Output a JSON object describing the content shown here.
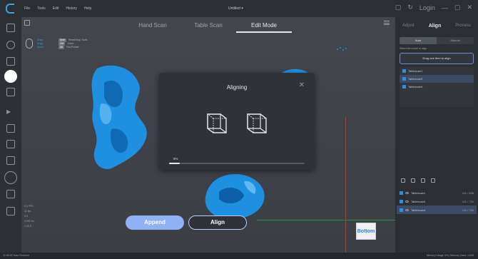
{
  "app": {
    "menu": [
      "File",
      "Tools",
      "Edit",
      "History",
      "Help"
    ],
    "doc_title": "Untitled  ▾",
    "login": "Login"
  },
  "tabs": [
    "Hand Scan",
    "Table Scan",
    "Edit Mode"
  ],
  "active_tab": 2,
  "hint": {
    "rows": [
      "Drag",
      "Drag",
      "Scroll"
    ],
    "tags": [
      "Shift",
      "Ctrl",
      "Alt"
    ],
    "labels": [
      "Reset/Stop Tools",
      "Zoom",
      "Pan/Rotate"
    ]
  },
  "dialog": {
    "title": "Aligning",
    "progress_label": "8%",
    "progress": 0.08
  },
  "buttons": {
    "append": "Append",
    "align": "Align"
  },
  "stats": [
    "0.0 FPS",
    "11 fps",
    "0.0",
    "0.990 Hz",
    "1.00 S"
  ],
  "nav_cube": "Bottom",
  "right_panel": {
    "tabs": [
      "Adjust",
      "Align",
      "Process"
    ],
    "segment": [
      "Auto",
      "Manual"
    ],
    "hint": "Select the model to align",
    "drag_text": "Drag one item to align",
    "align_items": [
      "Tablescan1",
      "Tablescan3",
      "Tablescan4"
    ],
    "scans": [
      {
        "name": "Tablescan1",
        "count": "111 / 638"
      },
      {
        "name": "Tablescan3",
        "count": "111 / 730"
      },
      {
        "name": "Tablescan4",
        "count": "111 / 730"
      }
    ]
  },
  "status": {
    "left": "11:08:33 Scan Finished",
    "right": "Memory Usage: 5% | Memory Used: 14GB"
  },
  "colors": {
    "accent": "#3aa3d8",
    "scan": "#1f8fe0",
    "button": "#8fb1f5"
  }
}
